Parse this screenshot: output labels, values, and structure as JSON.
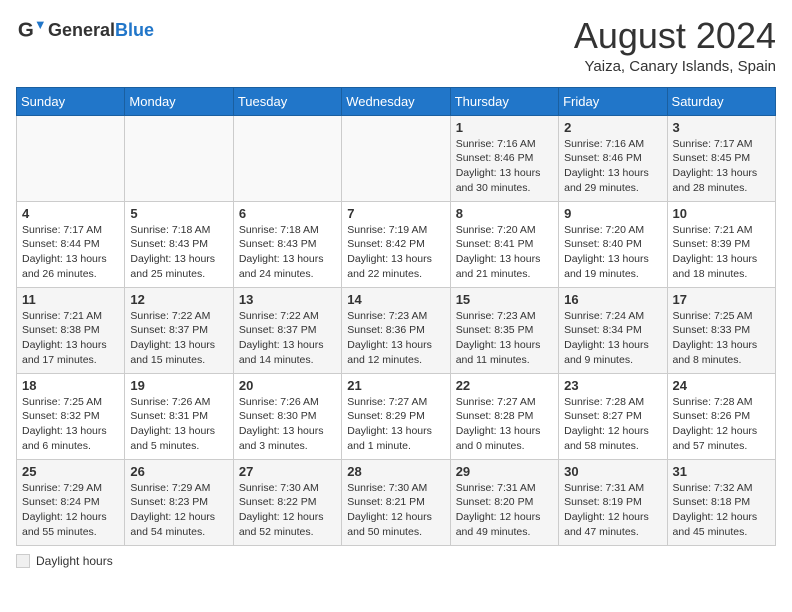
{
  "header": {
    "logo_general": "General",
    "logo_blue": "Blue",
    "title": "August 2024",
    "subtitle": "Yaiza, Canary Islands, Spain"
  },
  "days_of_week": [
    "Sunday",
    "Monday",
    "Tuesday",
    "Wednesday",
    "Thursday",
    "Friday",
    "Saturday"
  ],
  "weeks": [
    [
      {
        "day": "",
        "info": ""
      },
      {
        "day": "",
        "info": ""
      },
      {
        "day": "",
        "info": ""
      },
      {
        "day": "",
        "info": ""
      },
      {
        "day": "1",
        "info": "Sunrise: 7:16 AM\nSunset: 8:46 PM\nDaylight: 13 hours and 30 minutes."
      },
      {
        "day": "2",
        "info": "Sunrise: 7:16 AM\nSunset: 8:46 PM\nDaylight: 13 hours and 29 minutes."
      },
      {
        "day": "3",
        "info": "Sunrise: 7:17 AM\nSunset: 8:45 PM\nDaylight: 13 hours and 28 minutes."
      }
    ],
    [
      {
        "day": "4",
        "info": "Sunrise: 7:17 AM\nSunset: 8:44 PM\nDaylight: 13 hours and 26 minutes."
      },
      {
        "day": "5",
        "info": "Sunrise: 7:18 AM\nSunset: 8:43 PM\nDaylight: 13 hours and 25 minutes."
      },
      {
        "day": "6",
        "info": "Sunrise: 7:18 AM\nSunset: 8:43 PM\nDaylight: 13 hours and 24 minutes."
      },
      {
        "day": "7",
        "info": "Sunrise: 7:19 AM\nSunset: 8:42 PM\nDaylight: 13 hours and 22 minutes."
      },
      {
        "day": "8",
        "info": "Sunrise: 7:20 AM\nSunset: 8:41 PM\nDaylight: 13 hours and 21 minutes."
      },
      {
        "day": "9",
        "info": "Sunrise: 7:20 AM\nSunset: 8:40 PM\nDaylight: 13 hours and 19 minutes."
      },
      {
        "day": "10",
        "info": "Sunrise: 7:21 AM\nSunset: 8:39 PM\nDaylight: 13 hours and 18 minutes."
      }
    ],
    [
      {
        "day": "11",
        "info": "Sunrise: 7:21 AM\nSunset: 8:38 PM\nDaylight: 13 hours and 17 minutes."
      },
      {
        "day": "12",
        "info": "Sunrise: 7:22 AM\nSunset: 8:37 PM\nDaylight: 13 hours and 15 minutes."
      },
      {
        "day": "13",
        "info": "Sunrise: 7:22 AM\nSunset: 8:37 PM\nDaylight: 13 hours and 14 minutes."
      },
      {
        "day": "14",
        "info": "Sunrise: 7:23 AM\nSunset: 8:36 PM\nDaylight: 13 hours and 12 minutes."
      },
      {
        "day": "15",
        "info": "Sunrise: 7:23 AM\nSunset: 8:35 PM\nDaylight: 13 hours and 11 minutes."
      },
      {
        "day": "16",
        "info": "Sunrise: 7:24 AM\nSunset: 8:34 PM\nDaylight: 13 hours and 9 minutes."
      },
      {
        "day": "17",
        "info": "Sunrise: 7:25 AM\nSunset: 8:33 PM\nDaylight: 13 hours and 8 minutes."
      }
    ],
    [
      {
        "day": "18",
        "info": "Sunrise: 7:25 AM\nSunset: 8:32 PM\nDaylight: 13 hours and 6 minutes."
      },
      {
        "day": "19",
        "info": "Sunrise: 7:26 AM\nSunset: 8:31 PM\nDaylight: 13 hours and 5 minutes."
      },
      {
        "day": "20",
        "info": "Sunrise: 7:26 AM\nSunset: 8:30 PM\nDaylight: 13 hours and 3 minutes."
      },
      {
        "day": "21",
        "info": "Sunrise: 7:27 AM\nSunset: 8:29 PM\nDaylight: 13 hours and 1 minute."
      },
      {
        "day": "22",
        "info": "Sunrise: 7:27 AM\nSunset: 8:28 PM\nDaylight: 13 hours and 0 minutes."
      },
      {
        "day": "23",
        "info": "Sunrise: 7:28 AM\nSunset: 8:27 PM\nDaylight: 12 hours and 58 minutes."
      },
      {
        "day": "24",
        "info": "Sunrise: 7:28 AM\nSunset: 8:26 PM\nDaylight: 12 hours and 57 minutes."
      }
    ],
    [
      {
        "day": "25",
        "info": "Sunrise: 7:29 AM\nSunset: 8:24 PM\nDaylight: 12 hours and 55 minutes."
      },
      {
        "day": "26",
        "info": "Sunrise: 7:29 AM\nSunset: 8:23 PM\nDaylight: 12 hours and 54 minutes."
      },
      {
        "day": "27",
        "info": "Sunrise: 7:30 AM\nSunset: 8:22 PM\nDaylight: 12 hours and 52 minutes."
      },
      {
        "day": "28",
        "info": "Sunrise: 7:30 AM\nSunset: 8:21 PM\nDaylight: 12 hours and 50 minutes."
      },
      {
        "day": "29",
        "info": "Sunrise: 7:31 AM\nSunset: 8:20 PM\nDaylight: 12 hours and 49 minutes."
      },
      {
        "day": "30",
        "info": "Sunrise: 7:31 AM\nSunset: 8:19 PM\nDaylight: 12 hours and 47 minutes."
      },
      {
        "day": "31",
        "info": "Sunrise: 7:32 AM\nSunset: 8:18 PM\nDaylight: 12 hours and 45 minutes."
      }
    ]
  ],
  "legend": {
    "box_label": "Daylight hours"
  }
}
